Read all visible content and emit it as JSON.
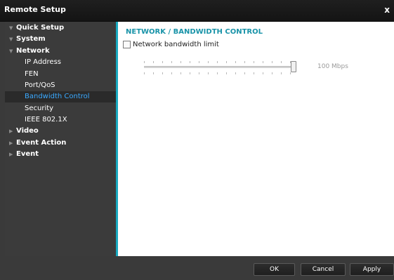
{
  "window": {
    "title": "Remote Setup",
    "close_label": "x"
  },
  "sidebar": {
    "items": [
      {
        "label": "Quick Setup",
        "level": 0,
        "expanded": true
      },
      {
        "label": "System",
        "level": 0,
        "expanded": true
      },
      {
        "label": "Network",
        "level": 0,
        "expanded": true
      },
      {
        "label": "IP Address",
        "level": 1
      },
      {
        "label": "FEN",
        "level": 1
      },
      {
        "label": "Port/QoS",
        "level": 1
      },
      {
        "label": "Bandwidth Control",
        "level": 1,
        "selected": true
      },
      {
        "label": "Security",
        "level": 1
      },
      {
        "label": "IEEE 802.1X",
        "level": 1
      },
      {
        "label": "Video",
        "level": 0,
        "expanded": false
      },
      {
        "label": "Event Action",
        "level": 0,
        "expanded": false
      },
      {
        "label": "Event",
        "level": 0,
        "expanded": false
      }
    ]
  },
  "main": {
    "section_title": "NETWORK / BANDWIDTH CONTROL",
    "bandwidth_limit": {
      "label": "Network bandwidth limit",
      "checked": false
    },
    "slider": {
      "value": 1.0,
      "value_label": "100 Mbps",
      "enabled": false
    }
  },
  "buttons": {
    "ok": "OK",
    "cancel": "Cancel",
    "apply": "Apply"
  },
  "colors": {
    "accent": "#18a9c0",
    "selected_text": "#3aa9ff",
    "section_title": "#1893a8"
  }
}
